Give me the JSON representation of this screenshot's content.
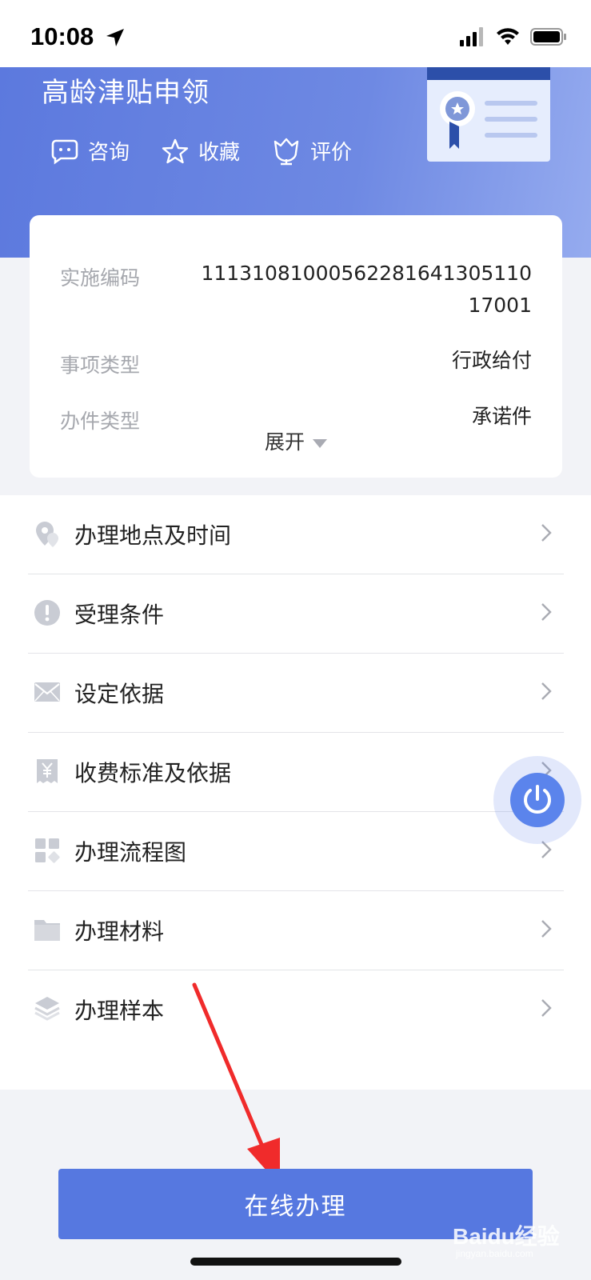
{
  "status_bar": {
    "time": "10:08"
  },
  "header": {
    "title": "高龄津贴申领",
    "actions": [
      {
        "label": "咨询",
        "icon": "chat-icon"
      },
      {
        "label": "收藏",
        "icon": "star-icon"
      },
      {
        "label": "评价",
        "icon": "tulip-icon"
      }
    ]
  },
  "info": {
    "rows": [
      {
        "label": "实施编码",
        "value_line1": "11131081000562281641305110",
        "value_line2": "17001"
      },
      {
        "label": "事项类型",
        "value": "行政给付"
      },
      {
        "label": "办件类型",
        "value": "承诺件"
      }
    ],
    "expand_label": "展开"
  },
  "menu": {
    "items": [
      {
        "label": "办理地点及时间",
        "icon": "location-icon"
      },
      {
        "label": "受理条件",
        "icon": "alert-icon"
      },
      {
        "label": "设定依据",
        "icon": "mail-icon"
      },
      {
        "label": "收费标准及依据",
        "icon": "yuan-receipt-icon"
      },
      {
        "label": "办理流程图",
        "icon": "grid-icon"
      },
      {
        "label": "办理材料",
        "icon": "folder-icon"
      },
      {
        "label": "办理样本",
        "icon": "layers-icon"
      }
    ]
  },
  "primary_button": {
    "label": "在线办理"
  },
  "watermark": {
    "main": "Baidu经验",
    "sub": "jingyan.baidu.com"
  },
  "colors": {
    "hero_start": "#5c79de",
    "hero_end": "#95abef",
    "primary": "#5678e0",
    "arrow": "#f02b2b",
    "float": "#5b84ec"
  }
}
